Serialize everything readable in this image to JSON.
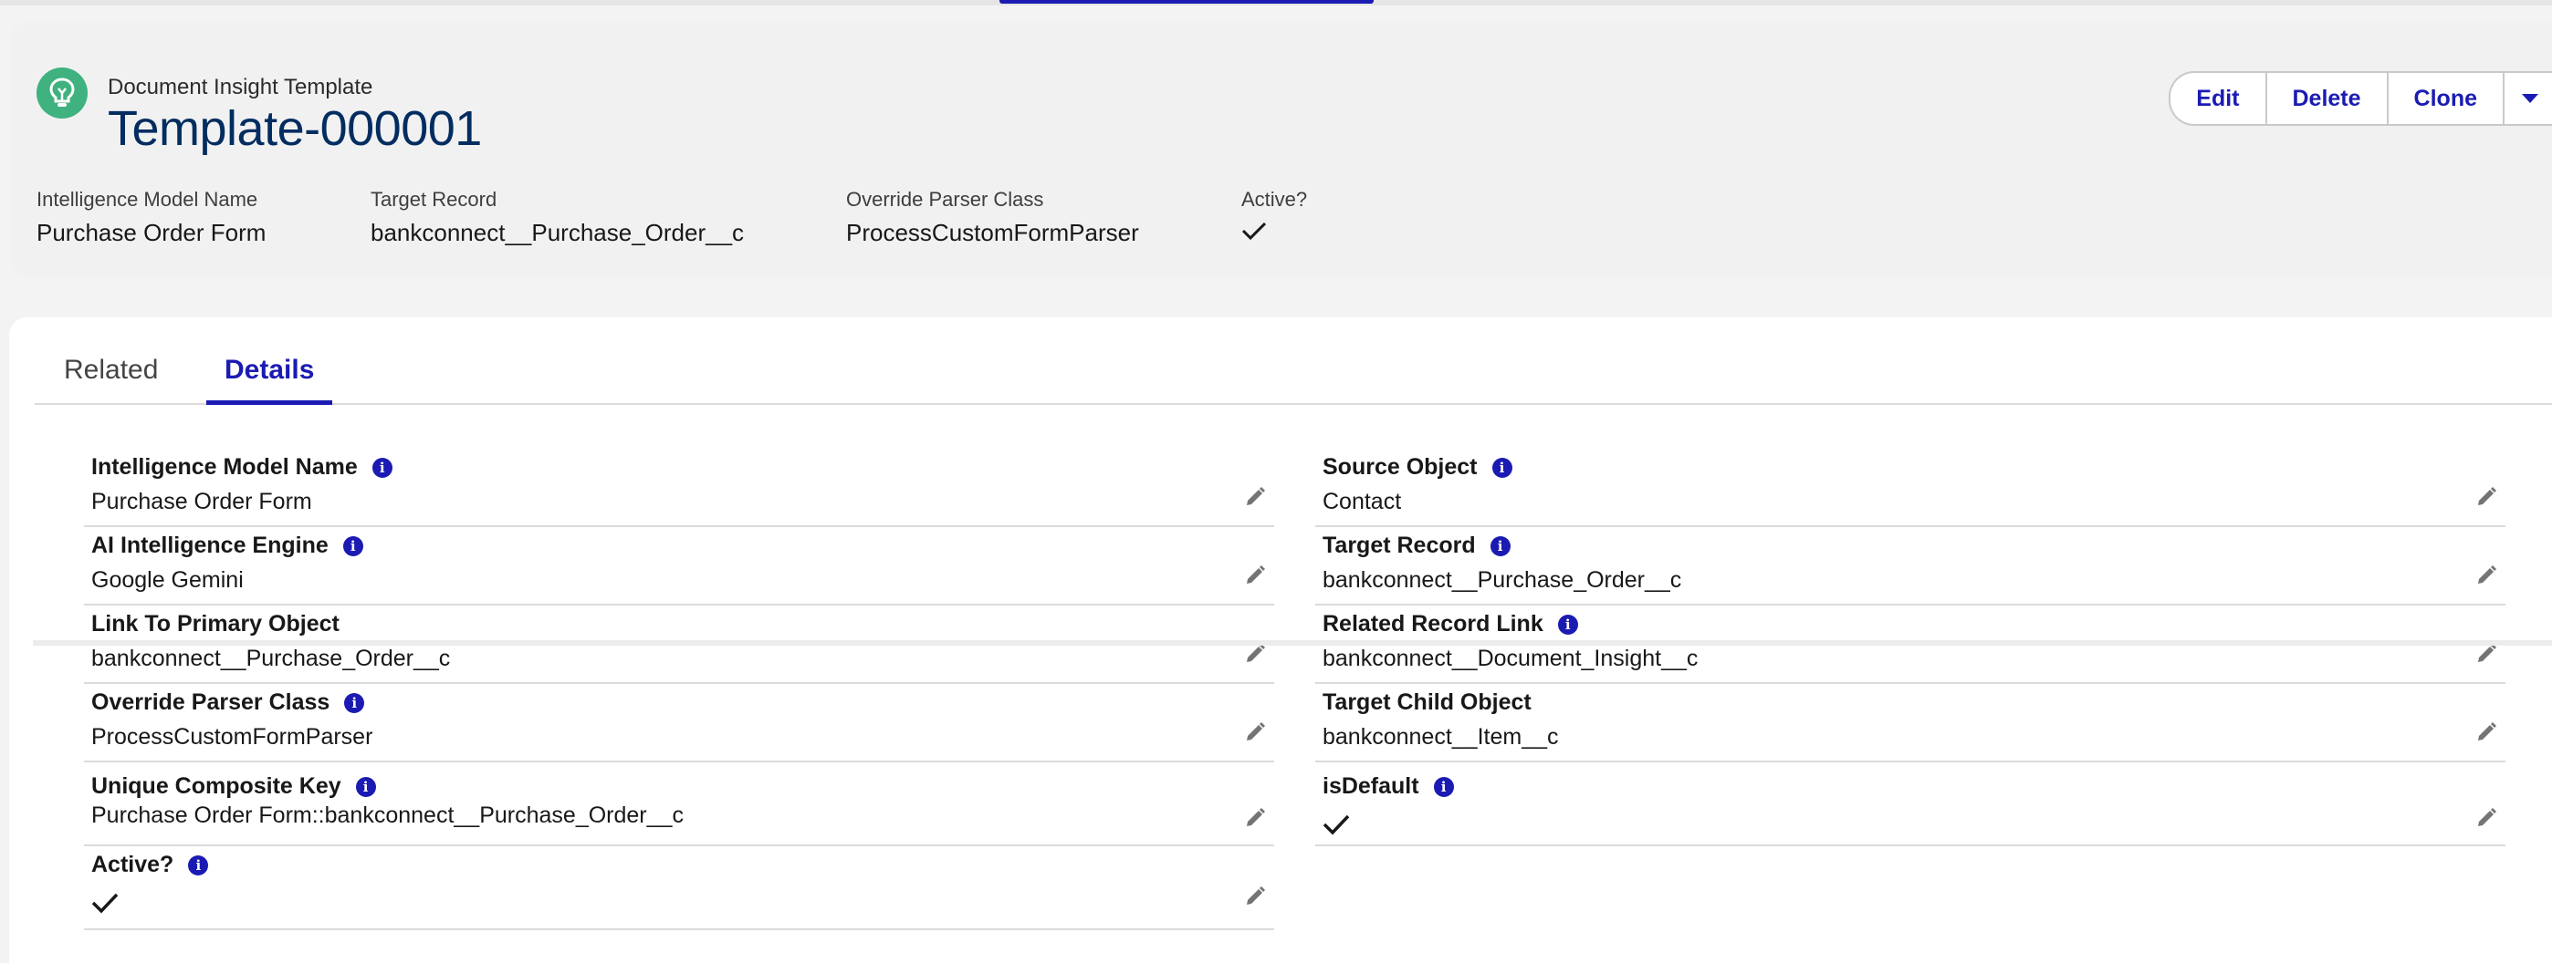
{
  "header": {
    "object_label": "Document Insight Template",
    "record_title": "Template-000001",
    "icon": "lightbulb-icon",
    "icon_color": "#3fb27f",
    "actions": {
      "edit": "Edit",
      "delete": "Delete",
      "clone": "Clone",
      "more_icon": "chevron-down-icon"
    },
    "highlights": [
      {
        "label": "Intelligence Model Name",
        "value": "Purchase Order Form"
      },
      {
        "label": "Target Record",
        "value": "bankconnect__Purchase_Order__c"
      },
      {
        "label": "Override Parser Class",
        "value": "ProcessCustomFormParser"
      },
      {
        "label": "Active?",
        "value": "checked"
      }
    ]
  },
  "tabs": {
    "related": "Related",
    "details": "Details",
    "active": "Details"
  },
  "details": {
    "left": [
      {
        "label": "Intelligence Model Name",
        "value": "Purchase Order Form",
        "info": true
      },
      {
        "label": "AI Intelligence Engine",
        "value": "Google Gemini",
        "info": true
      },
      {
        "label": "Link To Primary Object",
        "value": "bankconnect__Purchase_Order__c",
        "info": false
      },
      {
        "label": "Override Parser Class",
        "value": "ProcessCustomFormParser",
        "info": true
      },
      {
        "label": "Unique Composite Key",
        "value": "Purchase Order Form::bankconnect__Purchase_Order__c",
        "info": true
      },
      {
        "label": "Active?",
        "value": "checked",
        "info": true
      }
    ],
    "right": [
      {
        "label": "Source Object",
        "value": "Contact",
        "info": true
      },
      {
        "label": "Target Record",
        "value": "bankconnect__Purchase_Order__c",
        "info": true
      },
      {
        "label": "Related Record Link",
        "value": "bankconnect__Document_Insight__c",
        "info": true
      },
      {
        "label": "Target Child Object",
        "value": "bankconnect__Item__c",
        "info": false
      },
      {
        "label": "isDefault",
        "value": "checked",
        "info": true
      }
    ]
  },
  "colors": {
    "brand": "#1b1bb3",
    "title": "#032d60",
    "divider": "#dddbda"
  }
}
